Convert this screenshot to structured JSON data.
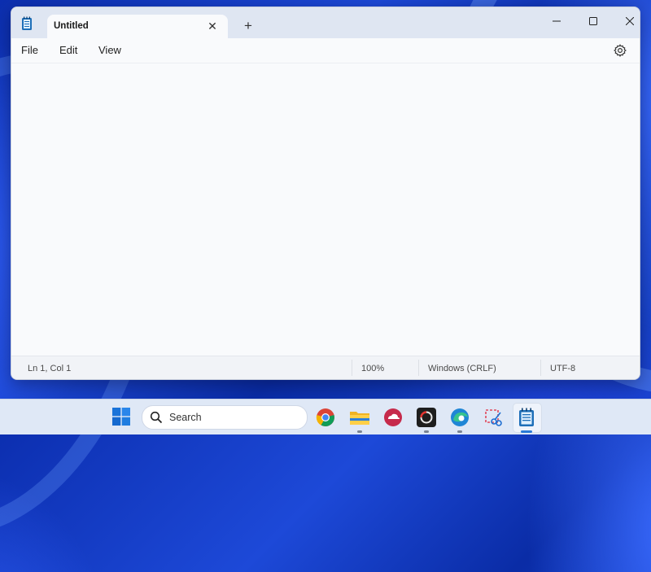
{
  "window": {
    "tab_title": "Untitled",
    "tab_close_glyph": "✕",
    "new_tab_glyph": "+"
  },
  "menu": {
    "items": [
      "File",
      "Edit",
      "View"
    ]
  },
  "status": {
    "position": "Ln 1, Col 1",
    "zoom": "100%",
    "line_ending": "Windows (CRLF)",
    "encoding": "UTF-8"
  },
  "taskbar": {
    "search_placeholder": "Search",
    "apps": [
      "windows-start-icon",
      "chrome-icon",
      "file-explorer-icon",
      "cloud-app-icon",
      "media-app-icon",
      "edge-icon",
      "snipping-tool-icon",
      "notepad-icon"
    ]
  },
  "colors": {
    "accent": "#0067c0",
    "window_bg": "#f9fafc",
    "titlebar_bg": "#dfe6f2",
    "taskbar_bg": "#dfe8f6"
  }
}
